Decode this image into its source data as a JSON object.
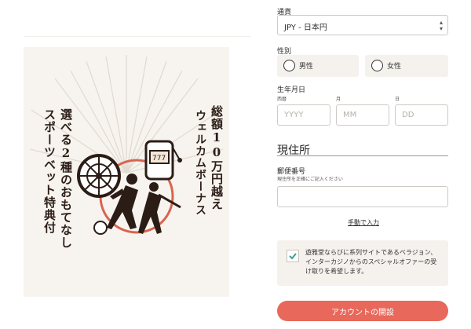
{
  "promo": {
    "right_col1": "総額10万円越え",
    "right_col2": "ウェルカムボーナス",
    "right_col3": "",
    "left_col1": "選べる2種のおもてなし",
    "left_col2": "スポーツベット特典付",
    "left_col3": ""
  },
  "form": {
    "currency_label": "通貨",
    "currency_value": "JPY - 日本円",
    "gender_label": "性別",
    "gender_male": "男性",
    "gender_female": "女性",
    "dob_label": "生年月日",
    "dob_year_label": "西暦",
    "dob_month_label": "月",
    "dob_day_label": "日",
    "dob_year_placeholder": "YYYY",
    "dob_month_placeholder": "MM",
    "dob_day_placeholder": "DD",
    "address_title": "現住所",
    "postal_label": "郵便番号",
    "postal_hint": "現住所を正確にご記入ください",
    "manual_link": "手動で入力",
    "consent_text": "遊雅堂ならびに系列サイトであるベラジョン、インターカジノからのスペシャルオファーの受け取りを希望します。",
    "consent_checked": true,
    "submit_label": "アカウントの開設"
  },
  "colors": {
    "accent": "#e8685b",
    "check": "#3aa08f",
    "promo_red": "#d9644f"
  }
}
